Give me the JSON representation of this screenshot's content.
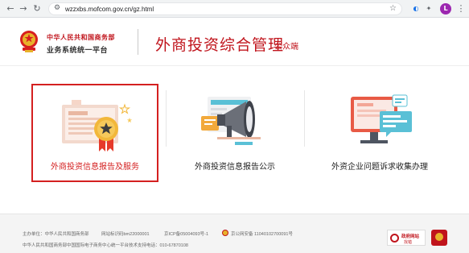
{
  "browser": {
    "url": "wzzxbs.mofcom.gov.cn/gz.html",
    "profile_initial": "L"
  },
  "header": {
    "ministry_name": "中华人民共和国商务部",
    "system_name": "业务系统统一平台",
    "title": "外商投资综合管理",
    "subtitle": "公众端"
  },
  "cards": [
    {
      "label": "外商投资信息报告及服务",
      "selected": true
    },
    {
      "label": "外商投资信息报告公示",
      "selected": false
    },
    {
      "label": "外资企业问题诉求收集办理",
      "selected": false
    }
  ],
  "footer": {
    "sponsor": "主办单位：中华人民共和国商务部",
    "site_id": "网站标识码bm22000001",
    "icp": "京ICP备05004093号-1",
    "police": "京公网安备 11040102700091号",
    "operator": "中华人民共和国商务部中国国际电子商务中心",
    "tech_support": "统一平台技术支持电话：010-67870108",
    "gov_badge_top": "政府网站",
    "gov_badge_bottom": "找错"
  },
  "colors": {
    "brand_red": "#c0141c",
    "selection_red": "#d42020"
  }
}
